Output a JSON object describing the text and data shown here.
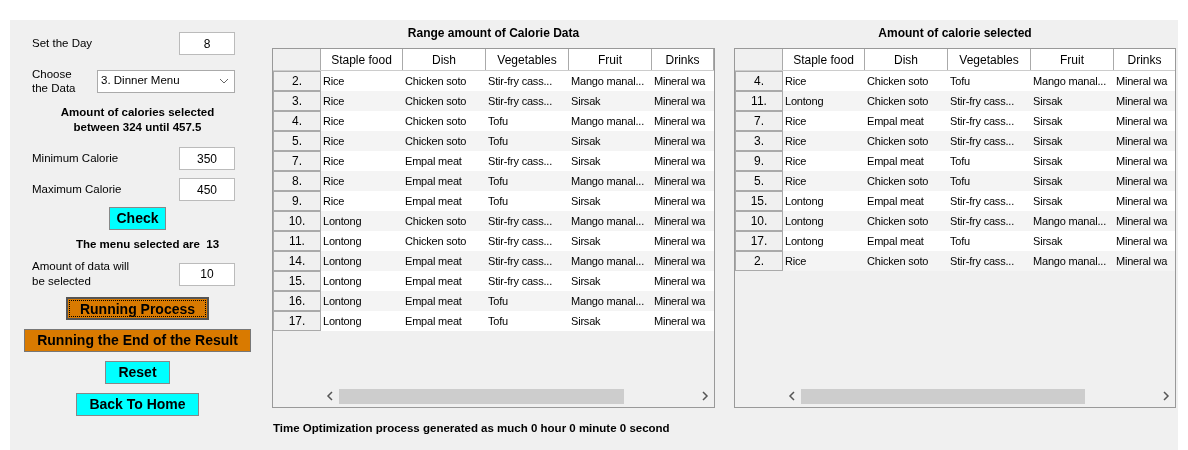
{
  "form": {
    "day": {
      "label": "Set the Day",
      "value": "8"
    },
    "choose": {
      "label": "Choose the Data",
      "value": "3. Dinner Menu"
    },
    "range_text": "Amount of calories selected between 324 until 457.5",
    "min": {
      "label": "Minimum Calorie",
      "value": "350"
    },
    "max": {
      "label": "Maximum Calorie",
      "value": "450"
    },
    "check_button": "Check",
    "selected_text": "The menu selected are  13",
    "amount": {
      "label": "Amount of data will be selected",
      "value": "10"
    },
    "buttons": [
      {
        "label": "Running Process",
        "kind": "focused"
      },
      {
        "label": "Running the End of the Result",
        "kind": "orange"
      },
      {
        "label": "Reset",
        "kind": "cyan"
      },
      {
        "label": "Back To Home",
        "kind": "cyan"
      }
    ]
  },
  "tables": [
    {
      "title": "Range amount of Calorie Data",
      "columns": [
        "Staple food",
        "Dish",
        "Vegetables",
        "Fruit",
        "Drinks"
      ],
      "rows": [
        {
          "index": "2.",
          "cells": [
            "Rice",
            "Chicken soto",
            "Stir-fry cass...",
            "Mango manal...",
            "Mineral wa"
          ]
        },
        {
          "index": "3.",
          "cells": [
            "Rice",
            "Chicken soto",
            "Stir-fry cass...",
            "Sirsak",
            "Mineral wa"
          ]
        },
        {
          "index": "4.",
          "cells": [
            "Rice",
            "Chicken soto",
            "Tofu",
            "Mango manal...",
            "Mineral wa"
          ]
        },
        {
          "index": "5.",
          "cells": [
            "Rice",
            "Chicken soto",
            "Tofu",
            "Sirsak",
            "Mineral wa"
          ]
        },
        {
          "index": "7.",
          "cells": [
            "Rice",
            "Empal meat",
            "Stir-fry cass...",
            "Sirsak",
            "Mineral wa"
          ]
        },
        {
          "index": "8.",
          "cells": [
            "Rice",
            "Empal meat",
            "Tofu",
            "Mango manal...",
            "Mineral wa"
          ]
        },
        {
          "index": "9.",
          "cells": [
            "Rice",
            "Empal meat",
            "Tofu",
            "Sirsak",
            "Mineral wa"
          ]
        },
        {
          "index": "10.",
          "cells": [
            "Lontong",
            "Chicken soto",
            "Stir-fry cass...",
            "Mango manal...",
            "Mineral wa"
          ]
        },
        {
          "index": "11.",
          "cells": [
            "Lontong",
            "Chicken soto",
            "Stir-fry cass...",
            "Sirsak",
            "Mineral wa"
          ]
        },
        {
          "index": "14.",
          "cells": [
            "Lontong",
            "Empal meat",
            "Stir-fry cass...",
            "Mango manal...",
            "Mineral wa"
          ]
        },
        {
          "index": "15.",
          "cells": [
            "Lontong",
            "Empal meat",
            "Stir-fry cass...",
            "Sirsak",
            "Mineral wa"
          ]
        },
        {
          "index": "16.",
          "cells": [
            "Lontong",
            "Empal meat",
            "Tofu",
            "Mango manal...",
            "Mineral wa"
          ]
        },
        {
          "index": "17.",
          "cells": [
            "Lontong",
            "Empal meat",
            "Tofu",
            "Sirsak",
            "Mineral wa"
          ]
        }
      ]
    },
    {
      "title": "Amount of calorie selected",
      "columns": [
        "Staple food",
        "Dish",
        "Vegetables",
        "Fruit",
        "Drinks"
      ],
      "rows": [
        {
          "index": "4.",
          "cells": [
            "Rice",
            "Chicken soto",
            "Tofu",
            "Mango manal...",
            "Mineral wa"
          ]
        },
        {
          "index": "11.",
          "cells": [
            "Lontong",
            "Chicken soto",
            "Stir-fry cass...",
            "Sirsak",
            "Mineral wa"
          ]
        },
        {
          "index": "7.",
          "cells": [
            "Rice",
            "Empal meat",
            "Stir-fry cass...",
            "Sirsak",
            "Mineral wa"
          ]
        },
        {
          "index": "3.",
          "cells": [
            "Rice",
            "Chicken soto",
            "Stir-fry cass...",
            "Sirsak",
            "Mineral wa"
          ]
        },
        {
          "index": "9.",
          "cells": [
            "Rice",
            "Empal meat",
            "Tofu",
            "Sirsak",
            "Mineral wa"
          ]
        },
        {
          "index": "5.",
          "cells": [
            "Rice",
            "Chicken soto",
            "Tofu",
            "Sirsak",
            "Mineral wa"
          ]
        },
        {
          "index": "15.",
          "cells": [
            "Lontong",
            "Empal meat",
            "Stir-fry cass...",
            "Sirsak",
            "Mineral wa"
          ]
        },
        {
          "index": "10.",
          "cells": [
            "Lontong",
            "Chicken soto",
            "Stir-fry cass...",
            "Mango manal...",
            "Mineral wa"
          ]
        },
        {
          "index": "17.",
          "cells": [
            "Lontong",
            "Empal meat",
            "Tofu",
            "Sirsak",
            "Mineral wa"
          ]
        },
        {
          "index": "2.",
          "cells": [
            "Rice",
            "Chicken soto",
            "Stir-fry cass...",
            "Mango manal...",
            "Mineral wa"
          ]
        }
      ]
    }
  ],
  "status_text": "Time Optimization process generated as much 0 hour 0 minute 0 second"
}
